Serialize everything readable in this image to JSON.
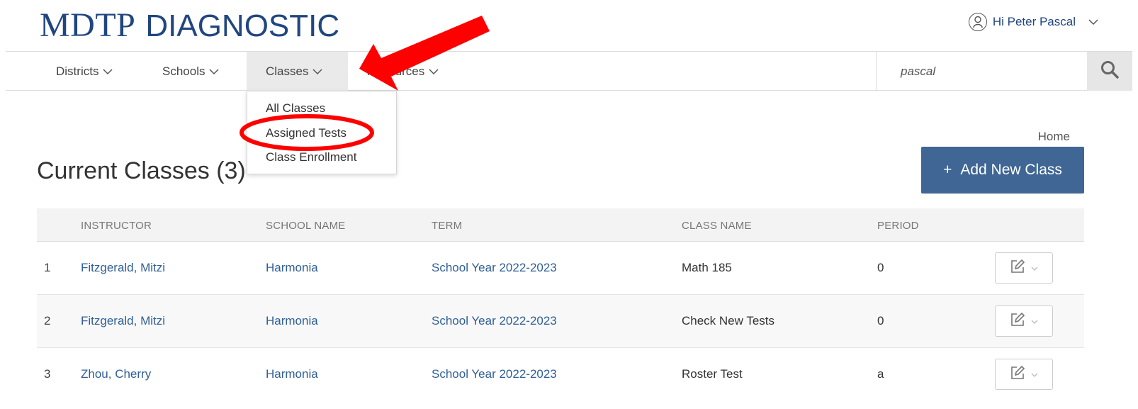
{
  "brand": {
    "mdtp": "MDTP",
    "diagnostic": "DIAGNOSTIC"
  },
  "user": {
    "greeting": "Hi Peter Pascal"
  },
  "nav": {
    "items": [
      {
        "label": "Districts"
      },
      {
        "label": "Schools"
      },
      {
        "label": "Classes"
      },
      {
        "label": "Resources"
      }
    ],
    "search_value": "pascal"
  },
  "dropdown": {
    "items": [
      {
        "label": "All Classes"
      },
      {
        "label": "Assigned Tests"
      },
      {
        "label": "Class Enrollment"
      }
    ]
  },
  "page": {
    "title": "Current Classes (3)",
    "breadcrumb": "Home",
    "add_button": "Add New Class",
    "add_button_icon": "+"
  },
  "table": {
    "headers": [
      "INSTRUCTOR",
      "SCHOOL NAME",
      "TERM",
      "CLASS NAME",
      "PERIOD"
    ],
    "rows": [
      {
        "num": "1",
        "instructor": "Fitzgerald, Mitzi",
        "school": "Harmonia",
        "term": "School Year 2022-2023",
        "class_name": "Math 185",
        "period": "0"
      },
      {
        "num": "2",
        "instructor": "Fitzgerald, Mitzi",
        "school": "Harmonia",
        "term": "School Year 2022-2023",
        "class_name": "Check New Tests",
        "period": "0"
      },
      {
        "num": "3",
        "instructor": "Zhou, Cherry",
        "school": "Harmonia",
        "term": "School Year 2022-2023",
        "class_name": "Roster Test",
        "period": "a"
      }
    ]
  },
  "colors": {
    "brand": "#21467f",
    "link": "#2f5f96",
    "button": "#3f6694",
    "annotation": "#ff0000"
  },
  "icons": {
    "user": "user-circle-icon",
    "search": "search-icon",
    "edit": "edit-pencil-icon",
    "chevron": "chevron-down-icon"
  }
}
